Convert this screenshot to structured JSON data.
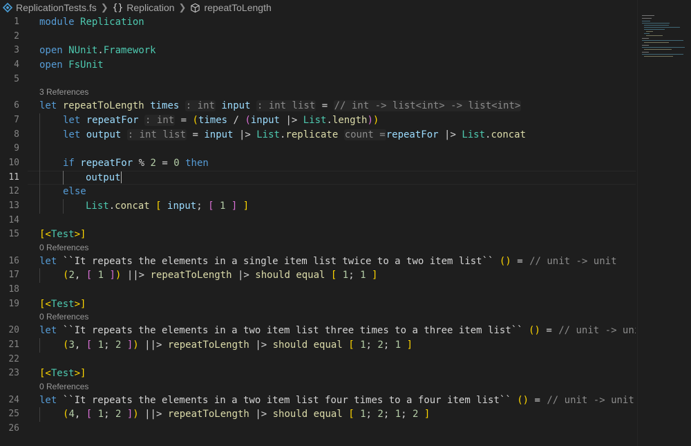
{
  "breadcrumb": {
    "file": "ReplicationTests.fs",
    "module": "Replication",
    "function": "repeatToLength",
    "braces": "{}",
    "separator": ">"
  },
  "lenses": {
    "l6": "3 References",
    "l15": "0 References",
    "l19": "0 References",
    "l23": "0 References"
  },
  "code": {
    "l1": {
      "n": "1",
      "kw": "module",
      "name": "Replication"
    },
    "l2": {
      "n": "2"
    },
    "l3": {
      "n": "3",
      "kw": "open",
      "ns": "NUnit",
      "dot": ".",
      "ns2": "Framework"
    },
    "l4": {
      "n": "4",
      "kw": "open",
      "ns": "FsUnit"
    },
    "l5": {
      "n": "5"
    },
    "l6": {
      "n": "6",
      "kw": "let",
      "fn": "repeatToLength",
      "p1": "times",
      "h1": ": int",
      "p2": "input",
      "h2": ": int list",
      "eq": "=",
      "comment": "// int -> list<int> -> list<int>"
    },
    "l7": {
      "n": "7",
      "kw": "let",
      "v": "repeatFor",
      "h": ": int",
      "eq": "=",
      "o1": "(",
      "a": "times",
      "div": "/",
      "o2": "(",
      "b": "input",
      "pipe": "|>",
      "m": "List",
      "dot": ".",
      "fn": "length",
      "c2": ")",
      "c1": ")"
    },
    "l8": {
      "n": "8",
      "kw": "let",
      "v": "output",
      "h": ": int list",
      "eq": "=",
      "a": "input",
      "pipe": "|>",
      "m": "List",
      "dot": ".",
      "fn": "replicate",
      "hint": "count =",
      "b": "repeatFor",
      "pipe2": "|>",
      "m2": "List",
      "dot2": ".",
      "fn2": "concat"
    },
    "l9": {
      "n": "9"
    },
    "l10": {
      "n": "10",
      "kw": "if",
      "v": "repeatFor",
      "mod": "%",
      "n2": "2",
      "eq": "=",
      "n0": "0",
      "kw2": "then"
    },
    "l11": {
      "n": "11",
      "v": "output"
    },
    "l12": {
      "n": "12",
      "kw": "else"
    },
    "l13": {
      "n": "13",
      "m": "List",
      "dot": ".",
      "fn": "concat",
      "o1": "[",
      "v": "input",
      "semi": ";",
      "o2": "[",
      "one": "1",
      "c2": "]",
      "c1": "]"
    },
    "l14": {
      "n": "14"
    },
    "l15": {
      "n": "15",
      "o": "[<",
      "attr": "Test",
      "c": ">]"
    },
    "l16": {
      "n": "16",
      "kw": "let",
      "name": "``It repeats the elements in a single item list twice to a two item list``",
      "unit": "()",
      "eq": "=",
      "comment": "// unit -> unit"
    },
    "l17": {
      "n": "17",
      "o1": "(",
      "num": "2",
      "comma": ",",
      "o2": "[",
      "e": "1",
      "c2": "]",
      "c1": ")",
      "pp": "||>",
      "fn": "repeatToLength",
      "pipe": "|>",
      "fn2": "should",
      "fn3": "equal",
      "o3": "[",
      "r1": "1",
      "s": ";",
      "r2": "1",
      "c3": "]"
    },
    "l18": {
      "n": "18"
    },
    "l19": {
      "n": "19",
      "o": "[<",
      "attr": "Test",
      "c": ">]"
    },
    "l20": {
      "n": "20",
      "kw": "let",
      "name": "``It repeats the elements in a two item list three times to a three item list``",
      "unit": "()",
      "eq": "=",
      "comment": "// unit -> uni"
    },
    "l21": {
      "n": "21",
      "o1": "(",
      "num": "3",
      "comma": ",",
      "o2": "[",
      "e1": "1",
      "s": ";",
      "e2": "2",
      "c2": "]",
      "c1": ")",
      "pp": "||>",
      "fn": "repeatToLength",
      "pipe": "|>",
      "fn2": "should",
      "fn3": "equal",
      "o3": "[",
      "r1": "1",
      "r2": "2",
      "r3": "1",
      "c3": "]"
    },
    "l22": {
      "n": "22"
    },
    "l23": {
      "n": "23",
      "o": "[<",
      "attr": "Test",
      "c": ">]"
    },
    "l24": {
      "n": "24",
      "kw": "let",
      "name": "``It repeats the elements in a two item list four times to a four item list``",
      "unit": "()",
      "eq": "=",
      "comment": "// unit -> unit"
    },
    "l25": {
      "n": "25",
      "o1": "(",
      "num": "4",
      "comma": ",",
      "o2": "[",
      "e1": "1",
      "s": ";",
      "e2": "2",
      "c2": "]",
      "c1": ")",
      "pp": "||>",
      "fn": "repeatToLength",
      "pipe": "|>",
      "fn2": "should",
      "fn3": "equal",
      "o3": "[",
      "r1": "1",
      "r2": "2",
      "r3": "1",
      "r4": "2",
      "c3": "]"
    },
    "l26": {
      "n": "26"
    }
  },
  "colors": {
    "background": "#1e1e1e",
    "keyword": "#569cd6",
    "type": "#4ec9b0",
    "function": "#dcdcaa",
    "variable": "#9cdcfe",
    "number": "#b5cea8",
    "comment": "#6a9955",
    "bracket1": "#ffd700",
    "bracket2": "#da70d6",
    "bracket3": "#179fff"
  }
}
